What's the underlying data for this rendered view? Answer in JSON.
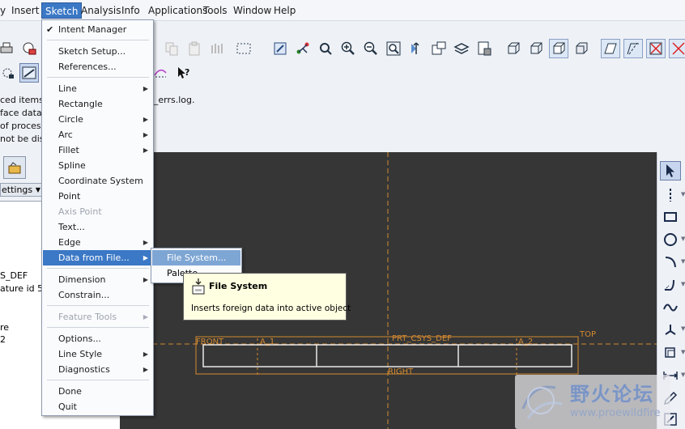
{
  "menubar": {
    "items": [
      {
        "label": "y",
        "name": "menu-view-partial"
      },
      {
        "label": "Insert",
        "name": "menu-insert"
      },
      {
        "label": "Sketch",
        "name": "menu-sketch"
      },
      {
        "label": "Analysis",
        "name": "menu-analysis"
      },
      {
        "label": "Info",
        "name": "menu-info"
      },
      {
        "label": "Applications",
        "name": "menu-applications"
      },
      {
        "label": "Tools",
        "name": "menu-tools"
      },
      {
        "label": "Window",
        "name": "menu-window"
      },
      {
        "label": "Help",
        "name": "menu-help"
      }
    ],
    "active": "Sketch"
  },
  "sketch_menu": {
    "items": [
      {
        "label": "Intent Manager",
        "checked": true,
        "enabled": true,
        "submenu": false
      },
      {
        "label": "Sketch Setup...",
        "enabled": true,
        "submenu": false
      },
      {
        "label": "References...",
        "enabled": true,
        "submenu": false
      },
      {
        "label": "Line",
        "enabled": true,
        "submenu": true
      },
      {
        "label": "Rectangle",
        "enabled": true,
        "submenu": false
      },
      {
        "label": "Circle",
        "enabled": true,
        "submenu": true
      },
      {
        "label": "Arc",
        "enabled": true,
        "submenu": true
      },
      {
        "label": "Fillet",
        "enabled": true,
        "submenu": true
      },
      {
        "label": "Spline",
        "enabled": true,
        "submenu": false
      },
      {
        "label": "Coordinate System",
        "enabled": true,
        "submenu": false
      },
      {
        "label": "Point",
        "enabled": true,
        "submenu": false
      },
      {
        "label": "Axis Point",
        "enabled": false,
        "submenu": false
      },
      {
        "label": "Text...",
        "enabled": true,
        "submenu": false
      },
      {
        "label": "Edge",
        "enabled": true,
        "submenu": true
      },
      {
        "label": "Data from File...",
        "enabled": true,
        "submenu": true,
        "highlighted": true
      },
      {
        "label": "Dimension",
        "enabled": true,
        "submenu": true
      },
      {
        "label": "Constrain...",
        "enabled": true,
        "submenu": false
      },
      {
        "label": "Feature Tools",
        "enabled": false,
        "submenu": true
      },
      {
        "label": "Options...",
        "enabled": true,
        "submenu": false
      },
      {
        "label": "Line Style",
        "enabled": true,
        "submenu": true
      },
      {
        "label": "Diagnostics",
        "enabled": true,
        "submenu": true
      },
      {
        "label": "Done",
        "enabled": true,
        "submenu": false
      },
      {
        "label": "Quit",
        "enabled": true,
        "submenu": false
      }
    ]
  },
  "submenu": {
    "items": [
      {
        "label": "File System...",
        "highlighted": true
      },
      {
        "label": "Palette..."
      }
    ]
  },
  "tooltip": {
    "title": "File System",
    "description": "Inserts foreign data into active object"
  },
  "message_area": {
    "lines": [
      "ced items w",
      "face data.",
      "of process",
      "not be disp"
    ],
    "file_ref": "f_errs.log."
  },
  "left_panel": {
    "settings_label": "ettings",
    "tree_lines": [
      "S_DEF",
      "ature id 51",
      "re",
      "2"
    ]
  },
  "sketch": {
    "labels": {
      "front": "FRONT",
      "a1": "A_1",
      "prt_csys": "PRT_CSYS_DEF",
      "a2": "A_2",
      "top": "TOP",
      "right": "RIGHT"
    },
    "colors": {
      "background": "#363636",
      "datum": "#d48a30",
      "geometry": "#e8e8e8"
    }
  },
  "watermark": {
    "title": "野火论坛",
    "url": "www.proewildfire"
  },
  "colors": {
    "menu_highlight": "#3b78c6",
    "submenu_highlight": "#7ea6d4",
    "tooltip_bg": "#ffffe1"
  }
}
